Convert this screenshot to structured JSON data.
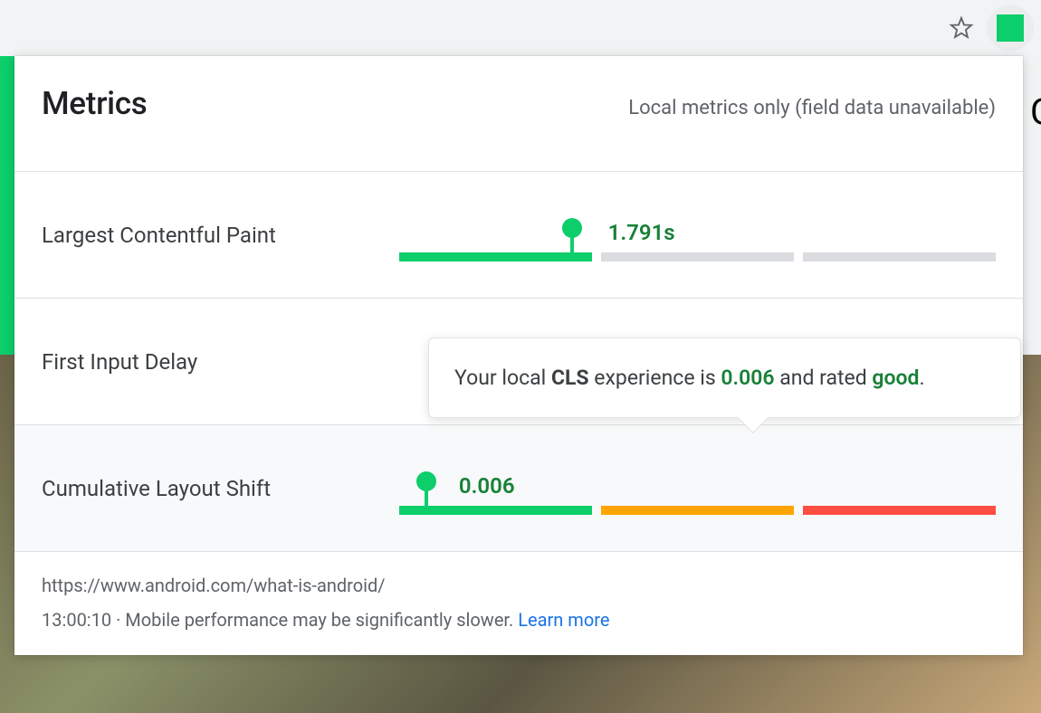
{
  "header": {
    "title": "Metrics",
    "subtitle": "Local metrics only (field data unavailable)"
  },
  "colors": {
    "good": "#0cce6b",
    "needs_improvement": "#ffa400",
    "poor": "#ff4e42",
    "inactive": "#dadce0",
    "good_text": "#188038"
  },
  "metrics": [
    {
      "id": "lcp",
      "label": "Largest Contentful Paint",
      "value_display": "1.791s",
      "marker_percent": 29,
      "value_left_percent": 35,
      "segments": [
        "green",
        "grey",
        "grey"
      ],
      "highlighted": false
    },
    {
      "id": "fid",
      "label": "First Input Delay",
      "value_display": "",
      "marker_percent": null,
      "value_left_percent": null,
      "segments": [],
      "highlighted": false
    },
    {
      "id": "cls",
      "label": "Cumulative Layout Shift",
      "value_display": "0.006",
      "marker_percent": 4.5,
      "value_left_percent": 10,
      "segments": [
        "green",
        "orange",
        "red"
      ],
      "highlighted": true
    }
  ],
  "tooltip": {
    "prefix": "Your local ",
    "metric_abbrev": "CLS",
    "mid": " experience is ",
    "value": "0.006",
    "mid2": " and rated ",
    "rating": "good",
    "suffix": "."
  },
  "footer": {
    "url": "https://www.android.com/what-is-android/",
    "time": "13:00:10",
    "separator": "  ·  ",
    "note": "Mobile performance may be significantly slower.",
    "link": "Learn more"
  },
  "stray_char": "C"
}
